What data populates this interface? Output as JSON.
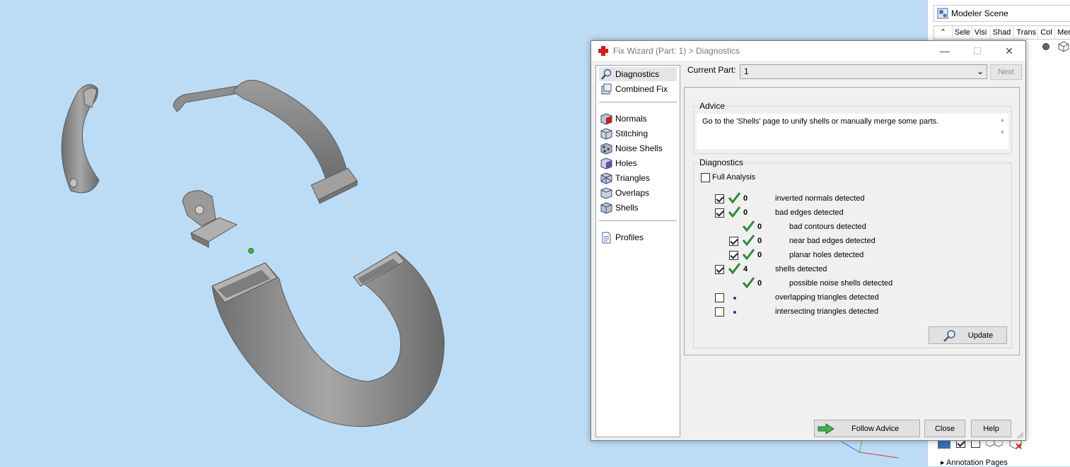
{
  "scene_panel": {
    "title": "Modeler Scene",
    "columns": [
      "Sele",
      "Visi",
      "Shad",
      "Trans",
      "Col",
      "Mer"
    ],
    "annotation": "Annotation Pages"
  },
  "dialog": {
    "title": "Fix Wizard (Part: 1) > Diagnostics",
    "nav": {
      "items_top": [
        "Diagnostics",
        "Combined Fix"
      ],
      "items_mid": [
        "Normals",
        "Stitching",
        "Noise Shells",
        "Holes",
        "Triangles",
        "Overlaps",
        "Shells"
      ],
      "items_bottom": [
        "Profiles"
      ]
    },
    "current_part_label": "Current Part:",
    "current_part_value": "1",
    "next_label": "Next",
    "advice_title": "Advice",
    "advice_text": "Go to the 'Shells' page to unify shells or manually merge some parts.",
    "diagnostics_title": "Diagnostics",
    "full_analysis_label": "Full Analysis",
    "rows": [
      {
        "count": "0",
        "label": "inverted normals detected",
        "checked": true
      },
      {
        "count": "0",
        "label": "bad edges detected",
        "checked": true
      },
      {
        "count": "0",
        "label": "bad contours detected",
        "checked": null
      },
      {
        "count": "0",
        "label": "near bad edges detected",
        "checked": true
      },
      {
        "count": "0",
        "label": "planar holes detected",
        "checked": true
      },
      {
        "count": "4",
        "label": "shells detected",
        "checked": true
      },
      {
        "count": "0",
        "label": "possible noise shells detected",
        "checked": null
      },
      {
        "count": "",
        "label": "overlapping triangles detected",
        "checked": false
      },
      {
        "count": "",
        "label": "intersecting triangles detected",
        "checked": false
      }
    ],
    "update_label": "Update",
    "follow_advice_label": "Follow Advice",
    "close_label": "Close",
    "help_label": "Help"
  },
  "colors": {
    "viewport_bg": "#bcdcf6",
    "model_gray": "#8a8a8a",
    "tick_green": "#2f8a3a",
    "arrow_green": "#3cb34a"
  }
}
